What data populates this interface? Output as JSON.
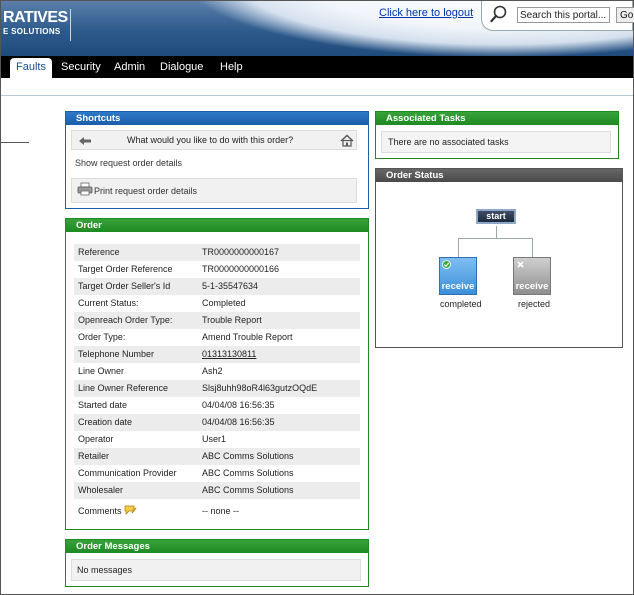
{
  "header": {
    "logo_main": "RATIVES",
    "logo_sub": "E SOLUTIONS",
    "logout_link": "Click here to logout",
    "search_value": "Search this portal...",
    "search_button": "Go"
  },
  "nav": {
    "items": [
      "Faults",
      "Security",
      "Admin",
      "Dialogue",
      "Help"
    ],
    "active": "Faults"
  },
  "shortcuts": {
    "title": "Shortcuts",
    "question": "What would you like to do with this order?",
    "show_details": "Show request order details",
    "print_details": "Print request order details"
  },
  "order": {
    "title": "Order",
    "rows": [
      {
        "label": "Reference",
        "value": "TR0000000000167"
      },
      {
        "label": "Target Order Reference",
        "value": "TR0000000000166"
      },
      {
        "label": "Target Order Seller's Id",
        "value": "5-1-35547634"
      },
      {
        "label": "Current Status:",
        "value": "Completed"
      },
      {
        "label": "Openreach Order Type:",
        "value": "Trouble Report"
      },
      {
        "label": "Order Type:",
        "value": "Amend Trouble Report"
      },
      {
        "label": "Telephone Number",
        "value": "01313130811"
      },
      {
        "label": "Line Owner",
        "value": "Ash2"
      },
      {
        "label": "Line Owner Reference",
        "value": "Slsj8uhh98oR4l63gutzOQdE"
      },
      {
        "label": "Started date",
        "value": "04/04/08 16:56:35"
      },
      {
        "label": "Creation date",
        "value": "04/04/08 16:56:35"
      },
      {
        "label": "Operator",
        "value": "User1"
      },
      {
        "label": "Retailer",
        "value": "ABC Comms Solutions"
      },
      {
        "label": "Communication Provider",
        "value": "ABC Comms Solutions"
      },
      {
        "label": "Wholesaler",
        "value": "ABC Comms Solutions"
      },
      {
        "label": "Comments",
        "value": "-- none --"
      }
    ]
  },
  "messages": {
    "title": "Order Messages",
    "text": "No messages"
  },
  "tasks": {
    "title": "Associated Tasks",
    "text": "There are no associated tasks"
  },
  "status": {
    "title": "Order Status",
    "start_label": "start",
    "node1_label": "receive",
    "node1_caption": "completed",
    "node2_label": "receive",
    "node2_caption": "rejected"
  },
  "colors": {
    "nav_bg": "#000000",
    "shortcuts_header": "#1b5ea9",
    "order_header": "#1f8a22",
    "status_header": "#4a4a4a"
  }
}
